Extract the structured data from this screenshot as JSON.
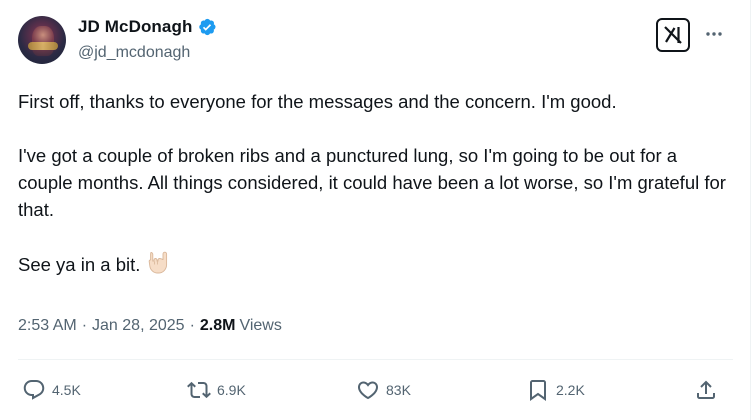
{
  "author": {
    "display_name": "JD McDonagh",
    "handle": "@jd_mcdonagh",
    "verified": true
  },
  "icons": {
    "verified": "verified-badge-icon",
    "grok": "grok-icon",
    "more": "more-options-icon",
    "reply": "reply-icon",
    "retweet": "retweet-icon",
    "like": "heart-icon",
    "bookmark": "bookmark-icon",
    "share": "share-icon",
    "emoji": "sign-of-the-horns-emoji"
  },
  "tweet": {
    "paragraphs": [
      "First off, thanks to everyone for the messages and the concern. I'm good.",
      "I've got a couple of broken ribs and a punctured lung, so I'm going to be out for a couple months. All things considered, it could have been a lot worse, so I'm grateful for that.",
      "See ya in a bit."
    ],
    "emoji": "🤘🏻"
  },
  "meta": {
    "time": "2:53 AM",
    "separator": "·",
    "date": "Jan 28, 2025",
    "views_count": "2.8M",
    "views_label": "Views"
  },
  "actions": {
    "replies": "4.5K",
    "retweets": "6.9K",
    "likes": "83K",
    "bookmarks": "2.2K"
  },
  "colors": {
    "text_primary": "#0f1419",
    "text_secondary": "#536471",
    "verified_blue": "#1d9bf0",
    "divider": "#eff3f4"
  }
}
